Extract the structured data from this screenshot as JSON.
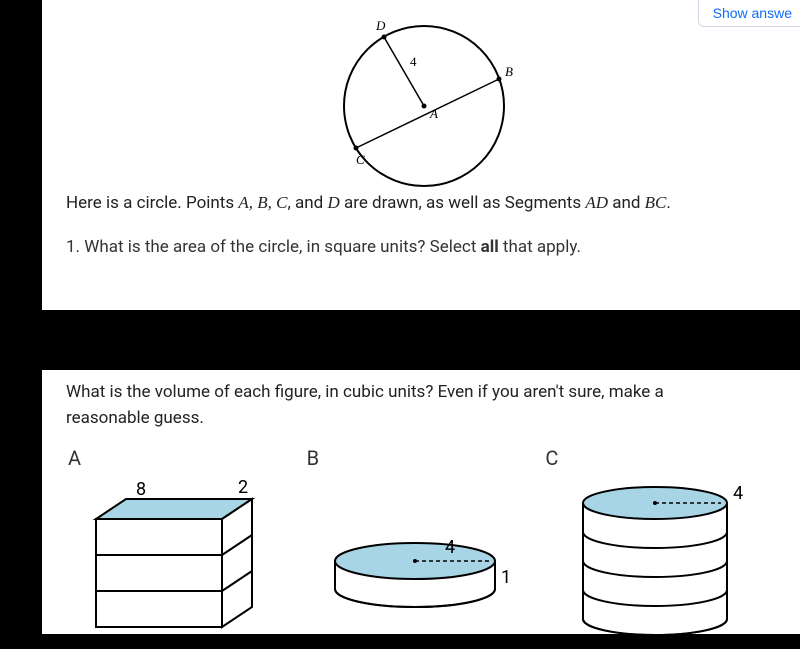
{
  "buttons": {
    "show_answer": "Show answe"
  },
  "circle": {
    "labels": {
      "A": "A",
      "B": "B",
      "C": "C",
      "D": "D",
      "chord_len": "4"
    }
  },
  "q1": {
    "intro_pre": "Here is a circle. Points ",
    "pts": "A,  B,  C",
    "intro_mid1": ", and ",
    "ptD": "D",
    "intro_mid2": " are drawn, as well as Segments ",
    "seg1": "AD",
    "intro_mid3": " and ",
    "seg2": "BC",
    "intro_end": ".",
    "sub_pre": "1. What is the area of the circle, in square units? Select ",
    "sub_bold": "all",
    "sub_post": " that apply."
  },
  "q2": {
    "text": "What is the volume of each figure, in cubic units? Even if you aren't sure, make a reasonable guess."
  },
  "figs": {
    "A": {
      "label": "A",
      "dim_long": "8",
      "dim_short": "2"
    },
    "B": {
      "label": "B",
      "radius": "4",
      "height": "1"
    },
    "C": {
      "label": "C",
      "radius": "4"
    }
  },
  "chart_data": [
    {
      "type": "diagram",
      "description": "Circle with center A, points B, C, D on circle; chord BC through A; segment AD; AD labeled length 4",
      "radius": 4
    },
    {
      "type": "diagram",
      "description": "Rectangular prism stack (3 layers), top face 8 by 2",
      "dims": {
        "length": 8,
        "width": 2,
        "layers": 3
      }
    },
    {
      "type": "diagram",
      "description": "Short cylinder, radius 4, height 1",
      "dims": {
        "radius": 4,
        "height": 1
      }
    },
    {
      "type": "diagram",
      "description": "Cylinder stack (4 layers), radius 4",
      "dims": {
        "radius": 4,
        "layers": 4
      }
    }
  ]
}
